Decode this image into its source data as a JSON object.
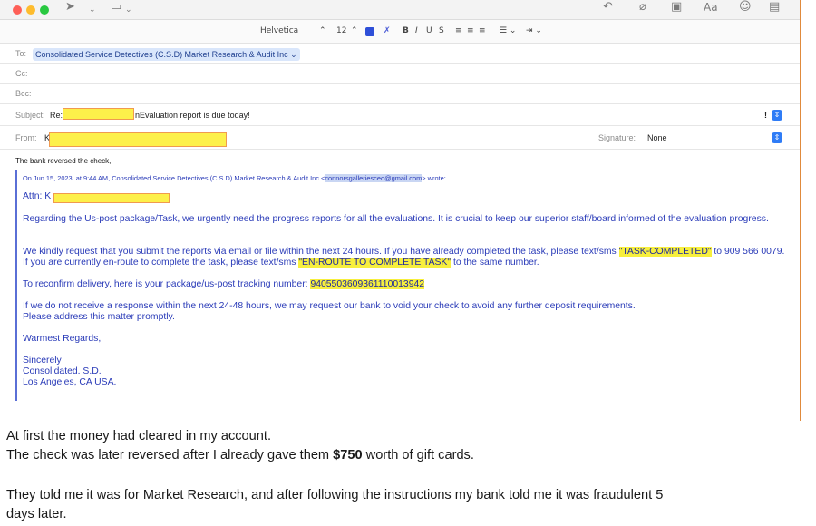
{
  "toolbar": {
    "icons": [
      "send-icon",
      "chevron-down-icon",
      "header-fields-icon",
      "chevron-down-icon",
      "reply-icon",
      "attachment-icon",
      "photo-icon",
      "font-icon",
      "emoji-icon",
      "media-icon"
    ]
  },
  "format_bar": {
    "font": "Helvetica",
    "font_chevron": "⌃",
    "size": "12",
    "size_chevron": "⌃",
    "bold": "B",
    "italic": "I",
    "underline": "U",
    "strike": "S",
    "align_left": "≡",
    "align_center": "≡",
    "align_right": "≡",
    "list": "☰ ⌄",
    "indent": "⇥ ⌄",
    "color": "#2e4fd8"
  },
  "header": {
    "to_label": "To:",
    "to_value": "Consolidated Service Detectives (C.S.D) Market Research & Audit Inc",
    "to_chevron": "⌄",
    "cc_label": "Cc:",
    "bcc_label": "Bcc:",
    "subject_label": "Subject:",
    "subject_prefix": "Re:",
    "subject_rest": "nEvaluation report is due today!",
    "priority": "!",
    "from_label": "From:",
    "from_initial": "K",
    "signature_label": "Signature:",
    "signature_value": "None"
  },
  "message": {
    "first_line": "The bank reversed the check,",
    "quote_head_pre": "On Jun 15, 2023, at 9:44 AM, Consolidated Service Detectives (C.S.D) Market Research & Audit Inc <",
    "quote_head_email": "connorsgalleriesceo@gmail.com",
    "quote_head_post": "> wrote:",
    "attn": "Attn: K",
    "p1": "Regarding the Us-post package/Task, we urgently need the progress reports for all the evaluations. It is crucial to keep our superior staff/board informed of the evaluation progress.",
    "p2_a": "We kindly request that you submit the reports via email or file within the next 24 hours. If you have already completed the task, please text/sms ",
    "p2_hl1": "\"TASK-COMPLETED\"",
    "p2_b": " to 909 566 0079. If you are currently en-route to complete the task, please text/sms ",
    "p2_hl2": "\"EN-ROUTE TO COMPLETE TASK\"",
    "p2_c": " to the same number.",
    "p3_a": "To reconfirm delivery, here is your package/us-post tracking number: ",
    "p3_hl": "9405503609361110013942",
    "p4_line1": "If we do not receive a response within the next 24-48 hours, we may request our bank to void your check to avoid any further deposit requirements.",
    "p4_line2": "Please address this matter promptly.",
    "regards": "Warmest Regards,",
    "sign1": "Sincerely",
    "sign2": "Consolidated. S.D.",
    "sign3": "Los Angeles, CA  USA."
  },
  "post": {
    "line1": "At first the money had cleared in my account.",
    "line2_a": "The check was later reversed after I already gave them ",
    "line2_bold": "$750",
    "line2_b": " worth of gift cards.",
    "line3": "They told me it was for Market Research, and after following the instructions my bank told me it was fraudulent 5",
    "line4": "days later."
  }
}
